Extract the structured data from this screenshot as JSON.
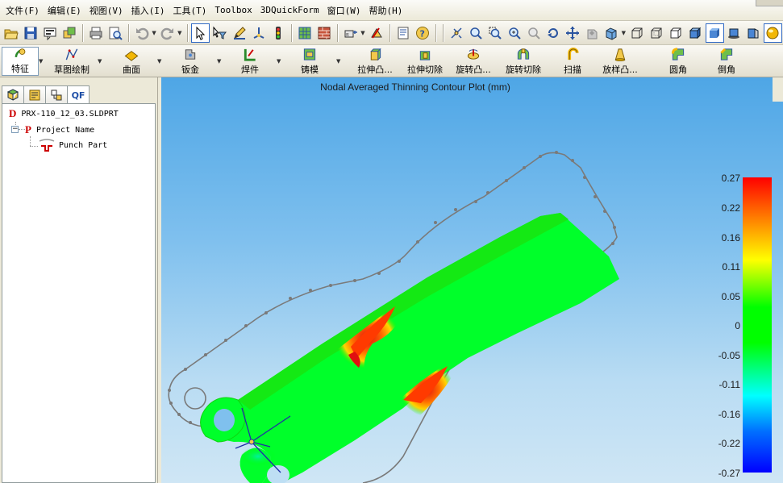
{
  "menu": {
    "items": [
      "文件(F)",
      "编辑(E)",
      "视图(V)",
      "插入(I)",
      "工具(T)",
      "Toolbox",
      "3DQuickForm",
      "窗口(W)",
      "帮助(H)"
    ]
  },
  "feature_toolbar": {
    "commands": [
      {
        "label": "特征",
        "icon": "features-icon",
        "dropdown": true
      },
      {
        "label": "草图绘制",
        "icon": "sketch-icon",
        "dropdown": true
      },
      {
        "label": "曲面",
        "icon": "surface-icon",
        "dropdown": true
      },
      {
        "label": "钣金",
        "icon": "sheet-metal-icon",
        "dropdown": true
      },
      {
        "label": "焊件",
        "icon": "weldment-icon",
        "dropdown": true
      },
      {
        "label": "铸模",
        "icon": "mold-icon",
        "dropdown": true
      },
      {
        "label": "拉伸凸...",
        "icon": "extrude-boss-icon",
        "dropdown": false
      },
      {
        "label": "拉伸切除",
        "icon": "extrude-cut-icon",
        "dropdown": false
      },
      {
        "label": "旋转凸...",
        "icon": "revolve-boss-icon",
        "dropdown": false
      },
      {
        "label": "旋转切除",
        "icon": "revolve-cut-icon",
        "dropdown": false
      },
      {
        "label": "扫描",
        "icon": "sweep-icon",
        "dropdown": false
      },
      {
        "label": "放样凸...",
        "icon": "loft-icon",
        "dropdown": false
      },
      {
        "label": "圆角",
        "icon": "fillet-icon",
        "dropdown": false
      },
      {
        "label": "倒角",
        "icon": "chamfer-icon",
        "dropdown": false
      }
    ]
  },
  "panel": {
    "tabs": [
      {
        "icon": "feature-manager-icon"
      },
      {
        "icon": "property-manager-icon"
      },
      {
        "icon": "configuration-manager-icon"
      },
      {
        "label": "QF"
      }
    ],
    "tree": {
      "root": {
        "letter": "D",
        "label": "PRX-110_12_03.SLDPRT"
      },
      "project": {
        "letter": "P",
        "label": "Project Name"
      },
      "part": {
        "label": "Punch Part"
      }
    }
  },
  "viewport": {
    "title": "Nodal Averaged Thinning Contour Plot (mm)",
    "colorbar_labels": [
      "0.27",
      "0.22",
      "0.16",
      "0.11",
      "0.05",
      "0",
      "-0.05",
      "-0.11",
      "-0.16",
      "-0.22",
      "-0.27"
    ],
    "colors": {
      "max": "#ff0000",
      "mid": "#00ff00",
      "min": "#0000ff",
      "outline": "#7a7a7a"
    }
  }
}
